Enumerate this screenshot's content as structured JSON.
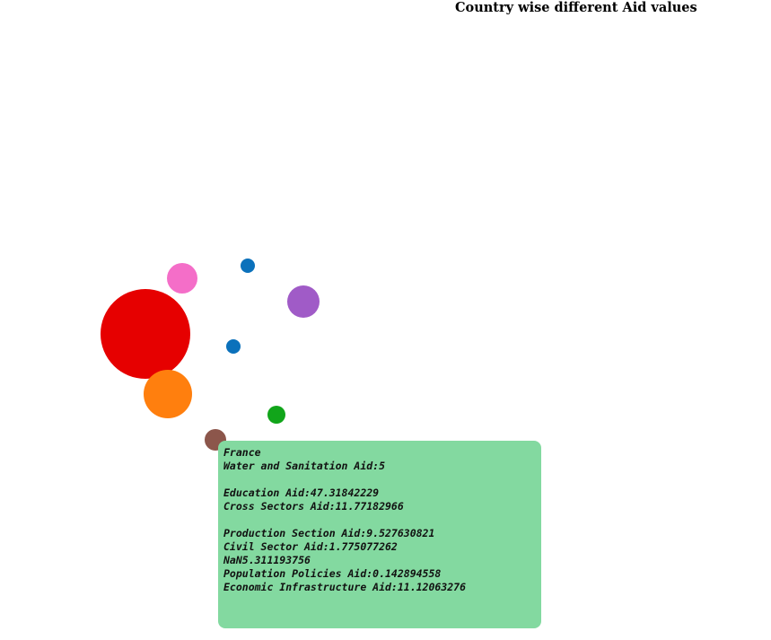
{
  "title": "Country wise different Aid values",
  "chart_data": {
    "type": "bubble",
    "title": "Country wise different Aid values",
    "bubbles": [
      {
        "color": "#f46ec8",
        "size": 17
      },
      {
        "color": "#0b71bb",
        "size": 8
      },
      {
        "color": "#a05bc7",
        "size": 18
      },
      {
        "color": "#e60000",
        "size": 50
      },
      {
        "color": "#0b71bb",
        "size": 8
      },
      {
        "color": "#ff7f0e",
        "size": 27
      },
      {
        "color": "#11a51a",
        "size": 10
      },
      {
        "color": "#8c564b",
        "size": 12
      }
    ]
  },
  "tooltip": {
    "lines": [
      "France",
      "Water and Sanitation Aid:5",
      "",
      "Education Aid:47.31842229",
      "Cross Sectors Aid:11.77182966",
      "",
      "Production Section Aid:9.527630821",
      "Civil Sector Aid:1.775077262",
      "NaN5.311193756",
      "Population Policies Aid:0.142894558",
      "Economic Infrastructure Aid:11.12063276"
    ]
  }
}
